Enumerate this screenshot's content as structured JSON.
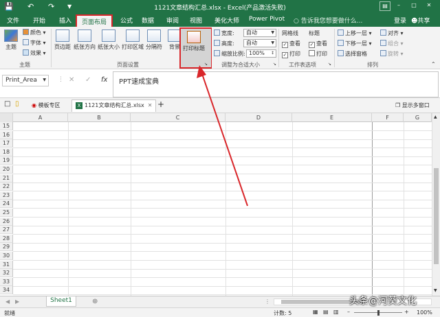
{
  "titlebar": {
    "title": "1121文章结构汇总.xlsx - Excel(产品激活失败)",
    "icons": [
      "save-icon",
      "undo-icon",
      "redo-icon",
      "customize-icon"
    ]
  },
  "tabs": [
    {
      "label": "文件"
    },
    {
      "label": "开始"
    },
    {
      "label": "插入"
    },
    {
      "label": "页面布局",
      "active": true
    },
    {
      "label": "公式"
    },
    {
      "label": "数据"
    },
    {
      "label": "审阅"
    },
    {
      "label": "视图"
    },
    {
      "label": "美化大师"
    },
    {
      "label": "Power Pivot"
    }
  ],
  "tell_me": "告诉我您想要做什么...",
  "account": {
    "login": "登录",
    "share": "共享"
  },
  "ribbon": {
    "theme": {
      "main": "主题",
      "colors": "颜色",
      "fonts": "字体",
      "effects": "效果",
      "group": "主题"
    },
    "page_setup": {
      "margins": "页边距",
      "orientation": "纸张方向",
      "size": "纸张大小",
      "print_area": "打印区域",
      "breaks": "分隔符",
      "background": "背景",
      "print_titles": "打印标题",
      "group": "页面设置"
    },
    "scale": {
      "width_label": "宽度:",
      "width_value": "自动",
      "height_label": "高度:",
      "height_value": "自动",
      "scale_label": "缩放比例:",
      "scale_value": "100%",
      "group": "调整为合适大小"
    },
    "sheet_options": {
      "gridlines": "网格线",
      "headings": "标题",
      "view": "查看",
      "print": "打印",
      "group": "工作表选项",
      "gridlines_view": true,
      "gridlines_print": true,
      "headings_view": true,
      "headings_print": false
    },
    "arrange": {
      "forward": "上移一层",
      "backward": "下移一层",
      "selection": "选择窗格",
      "align": "对齐",
      "group_btn": "组合",
      "rotate": "旋转",
      "group": "排列"
    }
  },
  "formula_bar": {
    "name_box": "Print_Area",
    "fx": "fx",
    "content": "PPT速成宝典"
  },
  "file_tabs": {
    "template": "模板专区",
    "file": "1121文章结构汇总.xlsx",
    "add": "+",
    "multi_window": "显示多窗口"
  },
  "grid": {
    "columns": [
      "A",
      "B",
      "C",
      "D",
      "E",
      "F",
      "G"
    ],
    "rows": [
      "15",
      "16",
      "17",
      "18",
      "19",
      "20",
      "21",
      "22",
      "23",
      "24",
      "25",
      "26",
      "27",
      "28",
      "29",
      "30",
      "31",
      "32",
      "33",
      "34"
    ]
  },
  "sheet": {
    "tab": "Sheet1"
  },
  "status": {
    "ready": "就绪",
    "count": "计数: 5",
    "zoom": "100%"
  },
  "watermark": "头条@河葵文化",
  "colors": {
    "excel_green": "#217346",
    "highlight_red": "#d9262a"
  }
}
